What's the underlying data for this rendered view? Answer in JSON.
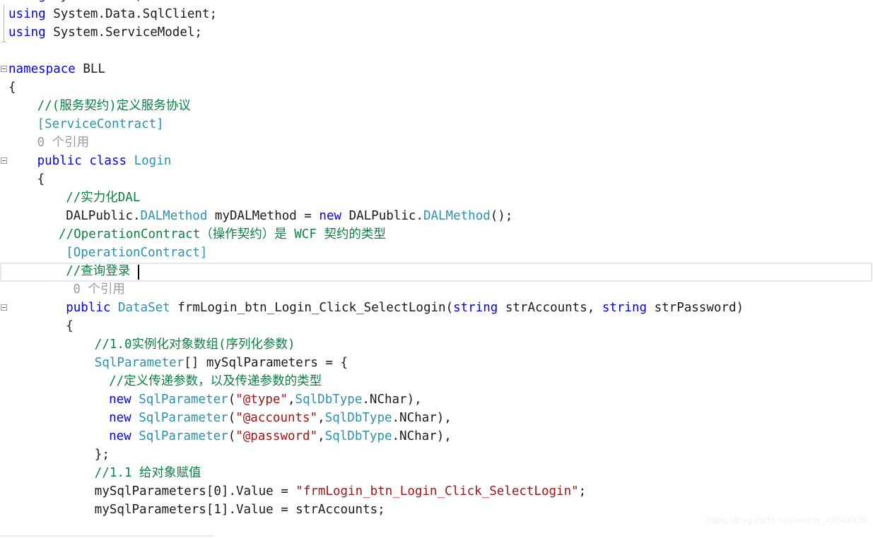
{
  "editor": {
    "app": "visual-studio-code-editor",
    "language": "csharp",
    "colors": {
      "background": "#ffffff",
      "foreground": "#1a1a1a",
      "keyword": "#0000ff",
      "type": "#2b91af",
      "comment": "#0c8043",
      "string": "#a31515",
      "codelens": "#9b9b9b",
      "current_line_border": "#e6e6f2",
      "gutter_marker": "#9a9a9a",
      "watermark": "#f0f0f0"
    },
    "current_line_number": 15,
    "caret_visible": true
  },
  "watermark": {
    "text": "https://blog.csdn.net/weixin_44543135"
  },
  "lines": [
    {
      "n": 1,
      "indent": 0,
      "clipped_top": true,
      "marker": "collapse",
      "tokens": [
        {
          "t": "using",
          "c": "kw"
        },
        {
          "t": " System.Data;",
          "c": "pln"
        }
      ]
    },
    {
      "n": 2,
      "indent": 0,
      "marker": "vline",
      "tokens": [
        {
          "t": "using",
          "c": "kw"
        },
        {
          "t": " System.Data.SqlClient;",
          "c": "pln"
        }
      ]
    },
    {
      "n": 3,
      "indent": 0,
      "marker": "vline-end",
      "tokens": [
        {
          "t": "using",
          "c": "kw"
        },
        {
          "t": " System.ServiceModel;",
          "c": "pln"
        }
      ]
    },
    {
      "n": 4,
      "indent": 0,
      "tokens": []
    },
    {
      "n": 5,
      "indent": 0,
      "marker": "collapse",
      "tokens": [
        {
          "t": "namespace",
          "c": "kw"
        },
        {
          "t": " BLL",
          "c": "pln"
        }
      ]
    },
    {
      "n": 6,
      "indent": 0,
      "tokens": [
        {
          "t": "{",
          "c": "pln"
        }
      ]
    },
    {
      "n": 7,
      "indent": 4,
      "tokens": [
        {
          "t": "//(服务契约)定义服务协议",
          "c": "cmt"
        }
      ]
    },
    {
      "n": 8,
      "indent": 4,
      "tokens": [
        {
          "t": "[ServiceContract]",
          "c": "typ"
        }
      ]
    },
    {
      "n": 9,
      "indent": 4,
      "codelens": true,
      "tokens": [
        {
          "t": "0 个引用",
          "c": "lens"
        }
      ]
    },
    {
      "n": 10,
      "indent": 4,
      "marker": "collapse",
      "tokens": [
        {
          "t": "public",
          "c": "kw"
        },
        {
          "t": " ",
          "c": "pln"
        },
        {
          "t": "class",
          "c": "kw"
        },
        {
          "t": " ",
          "c": "pln"
        },
        {
          "t": "Login",
          "c": "typ"
        }
      ]
    },
    {
      "n": 11,
      "indent": 4,
      "tokens": [
        {
          "t": "{",
          "c": "pln"
        }
      ]
    },
    {
      "n": 12,
      "indent": 8,
      "tokens": [
        {
          "t": "//实力化DAL",
          "c": "cmt"
        }
      ]
    },
    {
      "n": 13,
      "indent": 8,
      "tokens": [
        {
          "t": "DALPublic.",
          "c": "pln"
        },
        {
          "t": "DALMethod",
          "c": "typ"
        },
        {
          "t": " myDALMethod = ",
          "c": "pln"
        },
        {
          "t": "new",
          "c": "kw"
        },
        {
          "t": " DALPublic.",
          "c": "pln"
        },
        {
          "t": "DALMethod",
          "c": "typ"
        },
        {
          "t": "();",
          "c": "pln"
        }
      ]
    },
    {
      "n": 14,
      "indent": 7,
      "tokens": [
        {
          "t": "//OperationContract（操作契约）是 WCF 契约的类型",
          "c": "cmt"
        }
      ]
    },
    {
      "n": 15,
      "indent": 8,
      "tokens": [
        {
          "t": "[OperationContract]",
          "c": "typ"
        }
      ]
    },
    {
      "n": 16,
      "indent": 8,
      "current": true,
      "tokens": [
        {
          "t": "//查询登录",
          "c": "cmt"
        }
      ]
    },
    {
      "n": 17,
      "indent": 9,
      "codelens": true,
      "tokens": [
        {
          "t": "0 个引用",
          "c": "lens"
        }
      ]
    },
    {
      "n": 18,
      "indent": 8,
      "marker": "collapse",
      "tokens": [
        {
          "t": "public",
          "c": "kw"
        },
        {
          "t": " ",
          "c": "pln"
        },
        {
          "t": "DataSet",
          "c": "typ"
        },
        {
          "t": " frmLogin_btn_Login_Click_SelectLogin(",
          "c": "pln"
        },
        {
          "t": "string",
          "c": "kw"
        },
        {
          "t": " strAccounts, ",
          "c": "pln"
        },
        {
          "t": "string",
          "c": "kw"
        },
        {
          "t": " strPassword)",
          "c": "pln"
        }
      ]
    },
    {
      "n": 19,
      "indent": 8,
      "tokens": [
        {
          "t": "{",
          "c": "pln"
        }
      ]
    },
    {
      "n": 20,
      "indent": 12,
      "tokens": [
        {
          "t": "//1.0实例化对象数组(序列化参数)",
          "c": "cmt"
        }
      ]
    },
    {
      "n": 21,
      "indent": 12,
      "tokens": [
        {
          "t": "SqlParameter",
          "c": "typ"
        },
        {
          "t": "[] mySqlParameters = {",
          "c": "pln"
        }
      ]
    },
    {
      "n": 22,
      "indent": 14,
      "tokens": [
        {
          "t": "//定义传递参数，以及传递参数的类型",
          "c": "cmt"
        }
      ]
    },
    {
      "n": 23,
      "indent": 14,
      "tokens": [
        {
          "t": "new",
          "c": "kw"
        },
        {
          "t": " ",
          "c": "pln"
        },
        {
          "t": "SqlParameter",
          "c": "typ"
        },
        {
          "t": "(",
          "c": "pln"
        },
        {
          "t": "\"@type\"",
          "c": "str"
        },
        {
          "t": ",",
          "c": "pln"
        },
        {
          "t": "SqlDbType",
          "c": "typ"
        },
        {
          "t": ".NChar),",
          "c": "pln"
        }
      ]
    },
    {
      "n": 24,
      "indent": 14,
      "tokens": [
        {
          "t": "new",
          "c": "kw"
        },
        {
          "t": " ",
          "c": "pln"
        },
        {
          "t": "SqlParameter",
          "c": "typ"
        },
        {
          "t": "(",
          "c": "pln"
        },
        {
          "t": "\"@accounts\"",
          "c": "str"
        },
        {
          "t": ",",
          "c": "pln"
        },
        {
          "t": "SqlDbType",
          "c": "typ"
        },
        {
          "t": ".NChar),",
          "c": "pln"
        }
      ]
    },
    {
      "n": 25,
      "indent": 14,
      "tokens": [
        {
          "t": "new",
          "c": "kw"
        },
        {
          "t": " ",
          "c": "pln"
        },
        {
          "t": "SqlParameter",
          "c": "typ"
        },
        {
          "t": "(",
          "c": "pln"
        },
        {
          "t": "\"@password\"",
          "c": "str"
        },
        {
          "t": ",",
          "c": "pln"
        },
        {
          "t": "SqlDbType",
          "c": "typ"
        },
        {
          "t": ".NChar),",
          "c": "pln"
        }
      ]
    },
    {
      "n": 26,
      "indent": 12,
      "tokens": [
        {
          "t": "};",
          "c": "pln"
        }
      ]
    },
    {
      "n": 27,
      "indent": 12,
      "tokens": [
        {
          "t": "//1.1 给对象赋值",
          "c": "cmt"
        }
      ]
    },
    {
      "n": 28,
      "indent": 12,
      "tokens": [
        {
          "t": "mySqlParameters[0].Value = ",
          "c": "pln"
        },
        {
          "t": "\"frmLogin_btn_Login_Click_SelectLogin\"",
          "c": "str"
        },
        {
          "t": ";",
          "c": "pln"
        }
      ]
    },
    {
      "n": 29,
      "indent": 12,
      "tokens": [
        {
          "t": "mySqlParameters[1].Value = strAccounts;",
          "c": "pln"
        }
      ]
    }
  ]
}
